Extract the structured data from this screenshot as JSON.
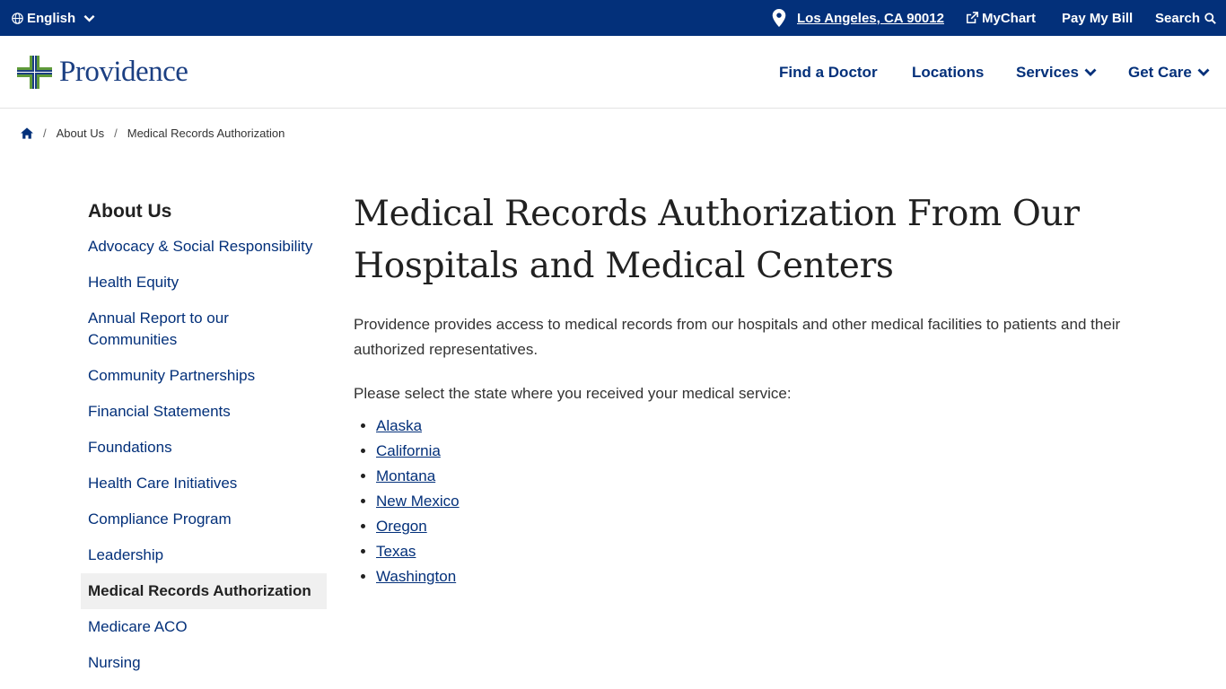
{
  "topbar": {
    "language": "English",
    "location": "Los Angeles, CA 90012",
    "mychart": "MyChart",
    "pay_bill": "Pay My Bill",
    "search": "Search"
  },
  "brand": {
    "name": "Providence",
    "primary_color": "#03307a",
    "accent_green": "#5f9a3a",
    "accent_blue": "#1b3f82"
  },
  "nav": {
    "find_doctor": "Find a Doctor",
    "locations": "Locations",
    "services": "Services",
    "get_care": "Get Care"
  },
  "breadcrumb": {
    "items": [
      "About Us",
      "Medical Records Authorization"
    ]
  },
  "sidebar": {
    "title": "About Us",
    "items": [
      {
        "label": "Advocacy & Social Responsibility"
      },
      {
        "label": "Health Equity"
      },
      {
        "label": "Annual Report to our Communities"
      },
      {
        "label": "Community Partnerships"
      },
      {
        "label": "Financial Statements"
      },
      {
        "label": "Foundations"
      },
      {
        "label": "Health Care Initiatives"
      },
      {
        "label": "Compliance Program"
      },
      {
        "label": "Leadership"
      },
      {
        "label": "Medical Records Authorization"
      },
      {
        "label": "Medicare ACO"
      },
      {
        "label": "Nursing"
      }
    ]
  },
  "main": {
    "title": "Medical Records Authorization From Our Hospitals and Medical Centers",
    "intro": "Providence provides access to medical records from our hospitals and other medical facilities to patients and their authorized representatives.",
    "prompt": "Please select the state where you received your medical service:",
    "states": [
      "Alaska",
      "California",
      "Montana",
      "New Mexico",
      "Oregon",
      "Texas",
      "Washington"
    ]
  }
}
